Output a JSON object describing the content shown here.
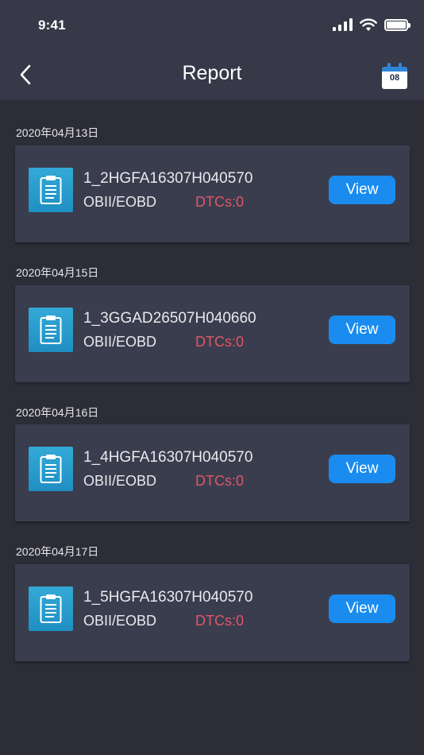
{
  "status_bar": {
    "time": "9:41",
    "signal_icon": "cellular-signal-icon",
    "wifi_icon": "wifi-icon",
    "battery_icon": "battery-icon"
  },
  "header": {
    "back_icon": "chevron-left-icon",
    "title": "Report",
    "calendar_icon": "calendar-icon",
    "calendar_day": "08"
  },
  "colors": {
    "header_bg": "#373948",
    "page_bg": "#2c2d37",
    "card_bg": "#3a3d4d",
    "accent": "#1a8cef",
    "dtc_text": "#e0566a",
    "report_icon_bg": "#2a9dcd"
  },
  "reports": [
    {
      "date": "2020年04月13日",
      "name": "1_2HGFA16307H040570",
      "protocol": "OBII/EOBD",
      "dtcs": "DTCs:0",
      "action_label": "View"
    },
    {
      "date": "2020年04月15日",
      "name": "1_3GGAD26507H040660",
      "protocol": "OBII/EOBD",
      "dtcs": "DTCs:0",
      "action_label": "View"
    },
    {
      "date": "2020年04月16日",
      "name": "1_4HGFA16307H040570",
      "protocol": "OBII/EOBD",
      "dtcs": "DTCs:0",
      "action_label": "View"
    },
    {
      "date": "2020年04月17日",
      "name": "1_5HGFA16307H040570",
      "protocol": "OBII/EOBD",
      "dtcs": "DTCs:0",
      "action_label": "View"
    }
  ]
}
